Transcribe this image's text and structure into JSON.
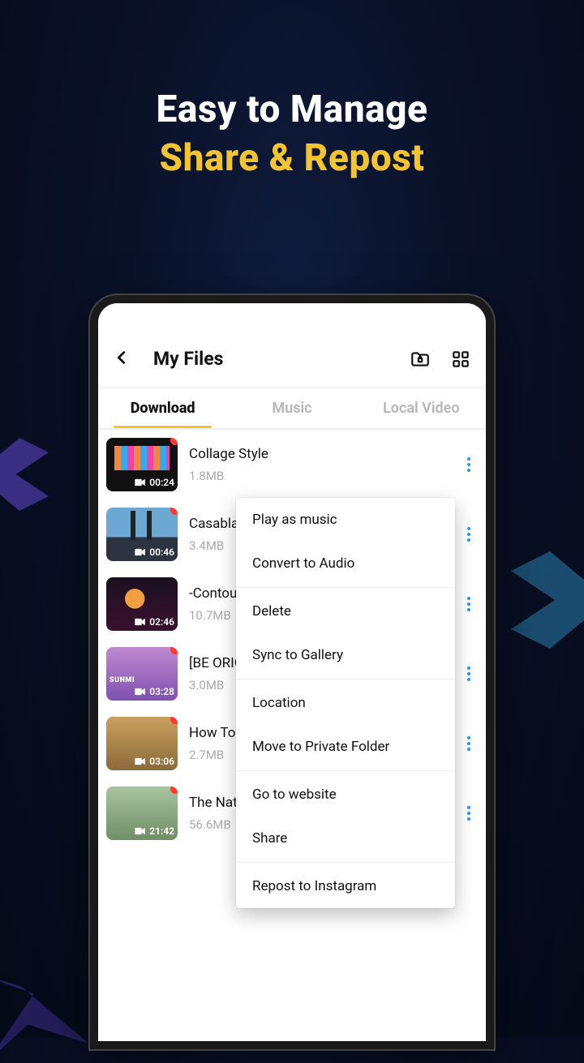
{
  "hero": {
    "line1": "Easy to Manage",
    "line2": "Share & Repost"
  },
  "appbar": {
    "title": "My Files"
  },
  "tabs": [
    {
      "label": "Download",
      "active": true
    },
    {
      "label": "Music",
      "active": false
    },
    {
      "label": "Local Video",
      "active": false
    }
  ],
  "files": [
    {
      "title": "Collage Style",
      "size": "1.8MB",
      "duration": "00:24",
      "new": true,
      "thumb": "th-0"
    },
    {
      "title": "Casablanca",
      "size": "3.4MB",
      "duration": "00:46",
      "new": true,
      "thumb": "th-1"
    },
    {
      "title": " -Contour",
      "size": "10.7MB",
      "duration": "02:46",
      "new": false,
      "thumb": "th-2"
    },
    {
      "title": "[BE ORIGINAL] with us",
      "size": "3.0MB",
      "duration": "03:28",
      "new": true,
      "thumb": "th-3"
    },
    {
      "title": "How To Bake Rice Cooker",
      "size": "2.7MB",
      "duration": "03:06",
      "new": true,
      "thumb": "th-4"
    },
    {
      "title": "The Nationals",
      "size": "56.6MB",
      "duration": "21:42",
      "new": true,
      "thumb": "th-5"
    }
  ],
  "menu": {
    "groups": [
      [
        "Play as music",
        "Convert to Audio"
      ],
      [
        "Delete",
        "Sync to Gallery"
      ],
      [
        "Location",
        "Move to Private Folder"
      ],
      [
        "Go to website",
        "Share"
      ],
      [
        "Repost to Instagram"
      ]
    ]
  }
}
